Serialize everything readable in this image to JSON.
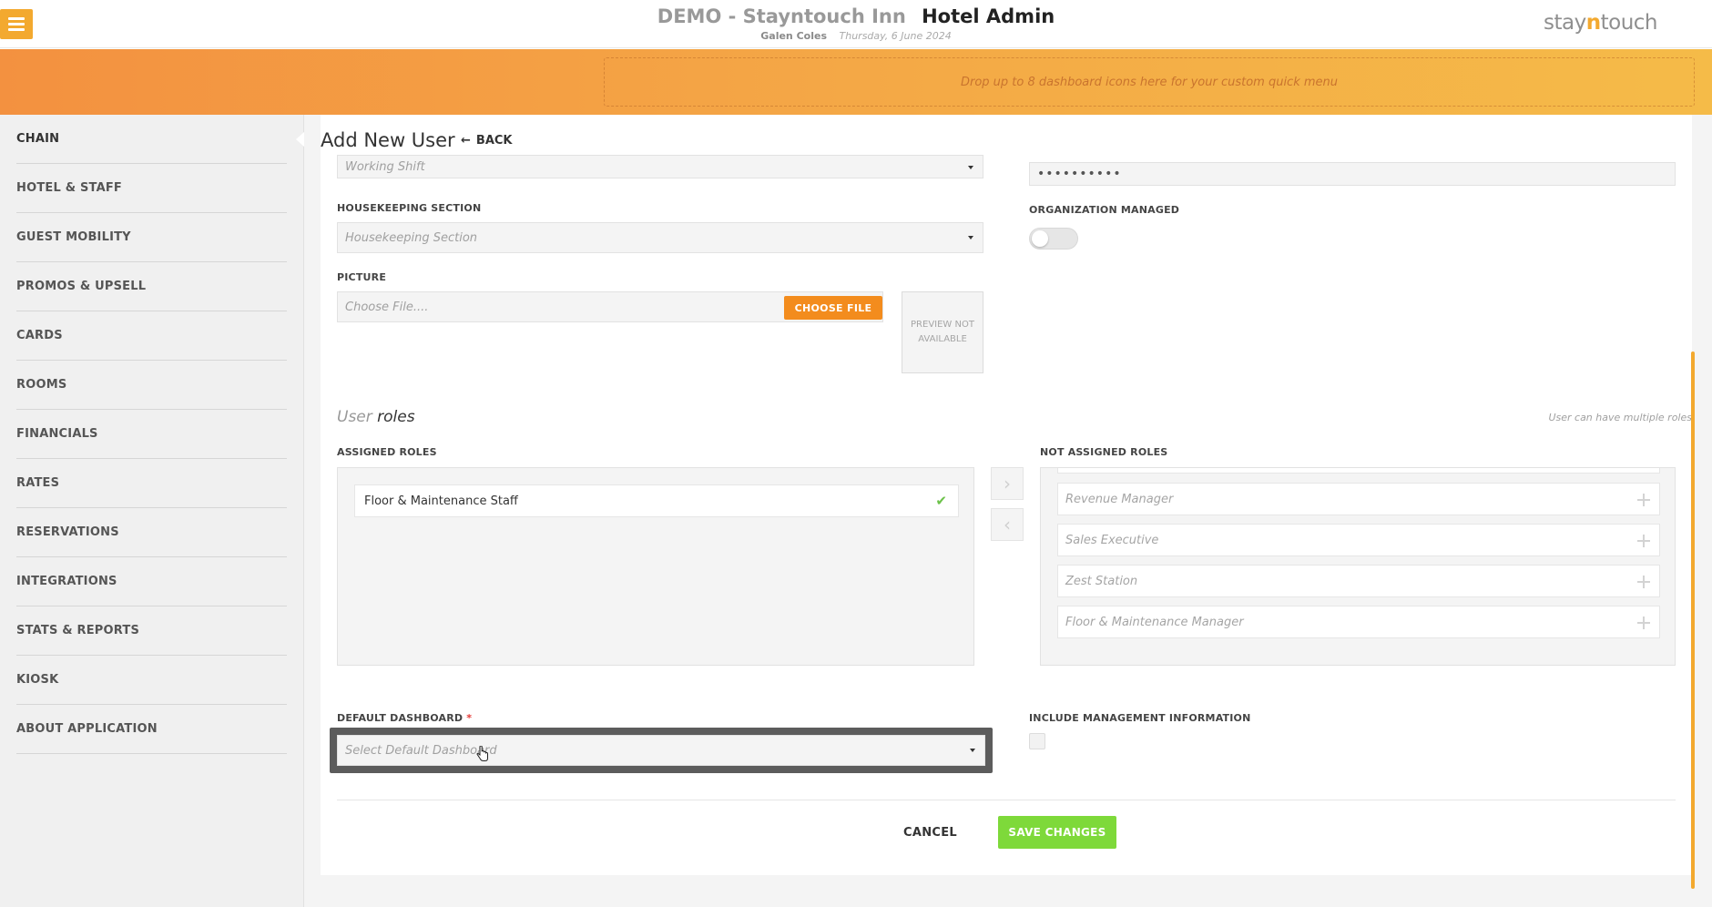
{
  "header": {
    "hotel_name": "DEMO - Stayntouch Inn",
    "app_name": "Hotel Admin",
    "user_name": "Galen Coles",
    "date": "Thursday, 6 June 2024",
    "logo_prefix": "stay",
    "logo_n": "n",
    "logo_suffix": "touch",
    "quick_menu_hint": "Drop up to 8 dashboard icons here for your custom quick menu"
  },
  "sidebar": {
    "items": [
      {
        "label": "CHAIN",
        "active": true
      },
      {
        "label": "HOTEL & STAFF"
      },
      {
        "label": "GUEST MOBILITY"
      },
      {
        "label": "PROMOS & UPSELL"
      },
      {
        "label": "CARDS"
      },
      {
        "label": "ROOMS"
      },
      {
        "label": "FINANCIALS"
      },
      {
        "label": "RATES"
      },
      {
        "label": "RESERVATIONS"
      },
      {
        "label": "INTEGRATIONS"
      },
      {
        "label": "STATS & REPORTS"
      },
      {
        "label": "KIOSK"
      },
      {
        "label": "ABOUT APPLICATION"
      }
    ]
  },
  "page": {
    "title": "Add New User",
    "back_label": "BACK"
  },
  "form": {
    "working_shift_placeholder": "Working Shift",
    "housekeeping_label": "HOUSEKEEPING SECTION",
    "housekeeping_placeholder": "Housekeeping Section",
    "picture_label": "PICTURE",
    "file_placeholder": "Choose File....",
    "choose_file_label": "CHOOSE FILE",
    "preview_text": "PREVIEW NOT AVAILABLE",
    "password_value": "••••••••••",
    "org_managed_label": "ORGANIZATION MANAGED",
    "org_managed_on": false
  },
  "roles": {
    "heading_a": "User",
    "heading_b": "roles",
    "hint": "User can have multiple roles",
    "assigned_label": "ASSIGNED ROLES",
    "not_assigned_label": "NOT ASSIGNED ROLES",
    "assigned": [
      "Floor & Maintenance Staff"
    ],
    "not_assigned": [
      "Revenue Manager",
      "Sales Executive",
      "Zest Station",
      "Floor & Maintenance Manager"
    ],
    "move_right_icon": "chevron-right-icon",
    "move_left_icon": "chevron-left-icon"
  },
  "dashboard": {
    "label": "DEFAULT DASHBOARD",
    "required_mark": "*",
    "placeholder": "Select Default Dashboard",
    "include_mgmt_label": "INCLUDE MANAGEMENT INFORMATION",
    "include_mgmt_checked": false
  },
  "actions": {
    "cancel_label": "CANCEL",
    "save_label": "SAVE CHANGES"
  },
  "colors": {
    "accent_orange": "#f3a92f",
    "button_orange": "#f38c1d",
    "save_green": "#7ed93a",
    "check_green": "#6cc24a"
  }
}
